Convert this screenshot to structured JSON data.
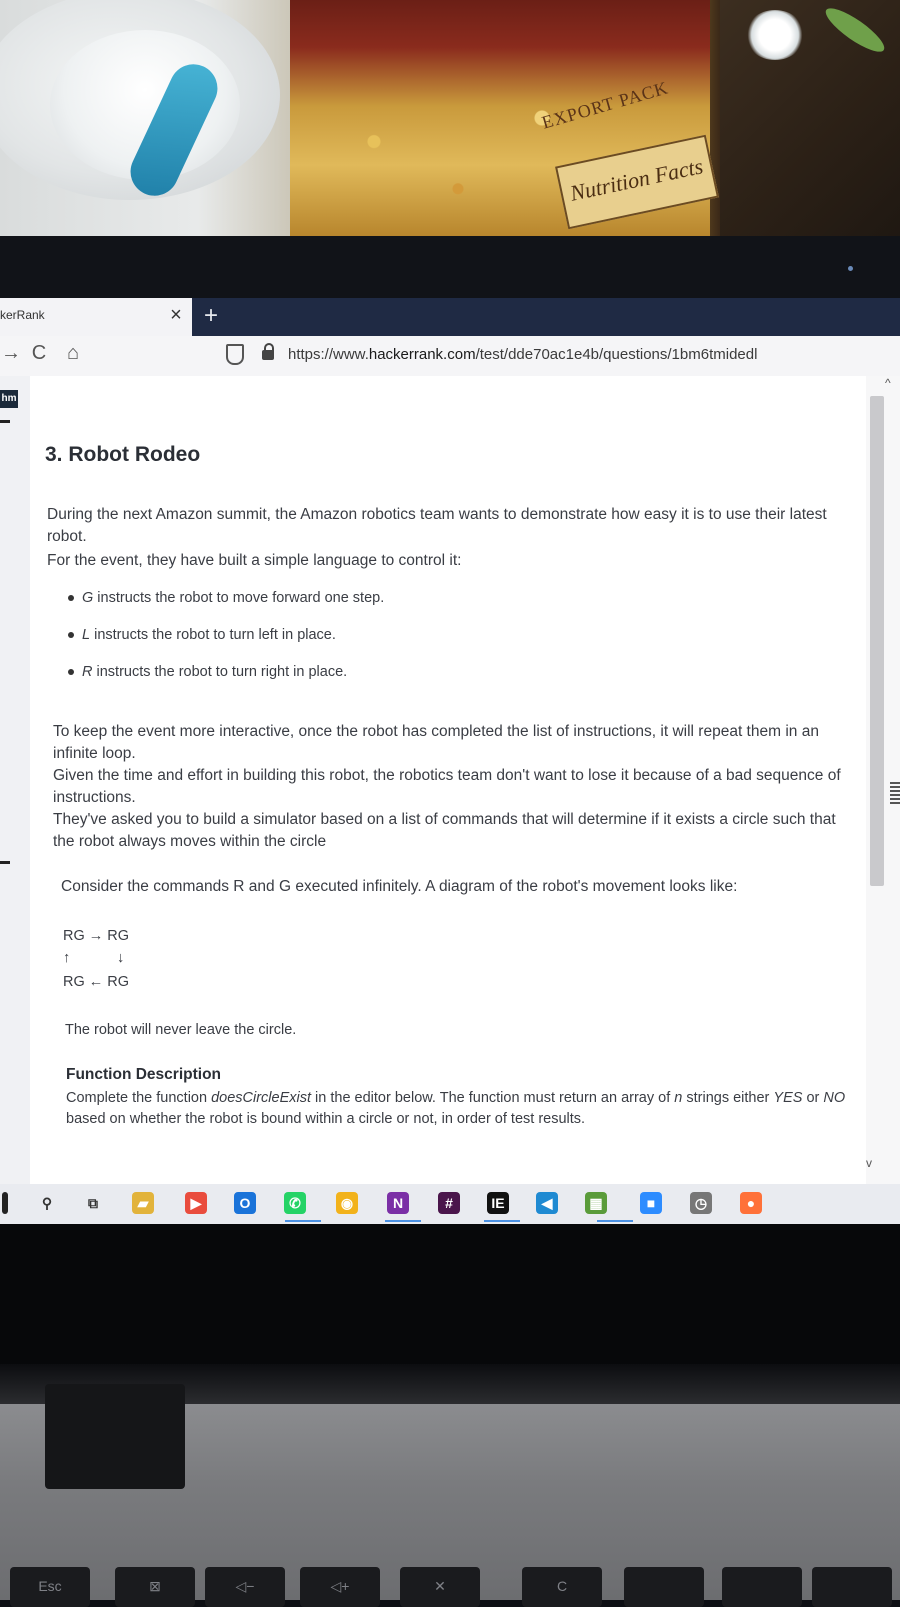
{
  "scene": {
    "snack_label": "Nutrition Facts",
    "export_label": "EXPORT PACK"
  },
  "browser": {
    "tab_title": "kerRank",
    "tab_close": "×",
    "new_tab": "+",
    "url_prefix": "https://www.",
    "url_domain": "hackerrank.com",
    "url_path": "/test/dde70ac1e4b/questions/1bm6tmidedl",
    "back_icon": "→",
    "reload_icon": "C",
    "home_icon": "⌂"
  },
  "sidebar": {
    "logo": "hm"
  },
  "question": {
    "title": "3. Robot Rodeo",
    "intro_1": "During the next Amazon summit, the Amazon robotics team wants to demonstrate how easy it is to use their latest robot.",
    "intro_2": "For the event, they have built a simple language to control it:",
    "bullets": [
      {
        "code": "G",
        "text": " instructs the robot to move forward one step."
      },
      {
        "code": "L",
        "text": " instructs the robot to turn left in place."
      },
      {
        "code": "R",
        "text": " instructs the robot to turn right in place."
      }
    ],
    "para_2": "To keep the event more interactive, once the robot has completed the list of instructions, it will repeat them in an infinite loop.",
    "para_3": "Given the time and effort in building this robot, the robotics team don't want to lose it because of a bad sequence of instructions.",
    "para_4": "They've asked you to build a simulator based on a list of commands that will determine if it exists a circle such that the robot always moves within the circle",
    "example_line": "Consider the commands R and G executed infinitely.  A diagram of the robot's movement looks like:",
    "diagram": {
      "row1": "RG → RG",
      "row2_up": "↑",
      "row2_down": "↓",
      "row3": "RG ← RG"
    },
    "conclusion": "The robot will never leave the circle.",
    "function_title": "Function Description",
    "function_pre": "Complete the function ",
    "function_name": "doesCircleExist",
    "function_mid": " in the editor below. The function must return an array of ",
    "function_n": "n",
    "function_mid2": " strings either ",
    "yes": "YES",
    "or": " or ",
    "no": "NO",
    "function_post": " based on whether the robot is bound within a circle or not, in order of test results."
  },
  "taskbar": {
    "icons": [
      {
        "name": "search-icon",
        "glyph": "⚲",
        "color": "#333"
      },
      {
        "name": "task-view-icon",
        "glyph": "⧉",
        "color": "#333"
      },
      {
        "name": "file-explorer-icon",
        "glyph": "▰",
        "color": "#e2b33b"
      },
      {
        "name": "media-player-icon",
        "glyph": "▶",
        "color": "#e94c3d"
      },
      {
        "name": "outlook-icon",
        "glyph": "O",
        "color": "#1a73d9"
      },
      {
        "name": "whatsapp-icon",
        "glyph": "✆",
        "color": "#25d366"
      },
      {
        "name": "chrome-icon",
        "glyph": "◉",
        "color": "#f2b21b"
      },
      {
        "name": "onenote-icon",
        "glyph": "N",
        "color": "#7b2fa6"
      },
      {
        "name": "slack-icon",
        "glyph": "#",
        "color": "#4a154b"
      },
      {
        "name": "intellij-icon",
        "glyph": "IE",
        "color": "#111"
      },
      {
        "name": "vscode-icon",
        "glyph": "◀",
        "color": "#1f8ad2"
      },
      {
        "name": "minecraft-icon",
        "glyph": "▦",
        "color": "#5a9b3a"
      },
      {
        "name": "zoom-icon",
        "glyph": "■",
        "color": "#2d8cff"
      },
      {
        "name": "clock-icon",
        "glyph": "◷",
        "color": "#777"
      },
      {
        "name": "firefox-icon",
        "glyph": "●",
        "color": "#ff7139"
      }
    ]
  },
  "keyboard": {
    "keys": [
      "Esc",
      "⊠",
      "◁−",
      "◁+",
      "✕",
      "C",
      "",
      "",
      ""
    ]
  }
}
